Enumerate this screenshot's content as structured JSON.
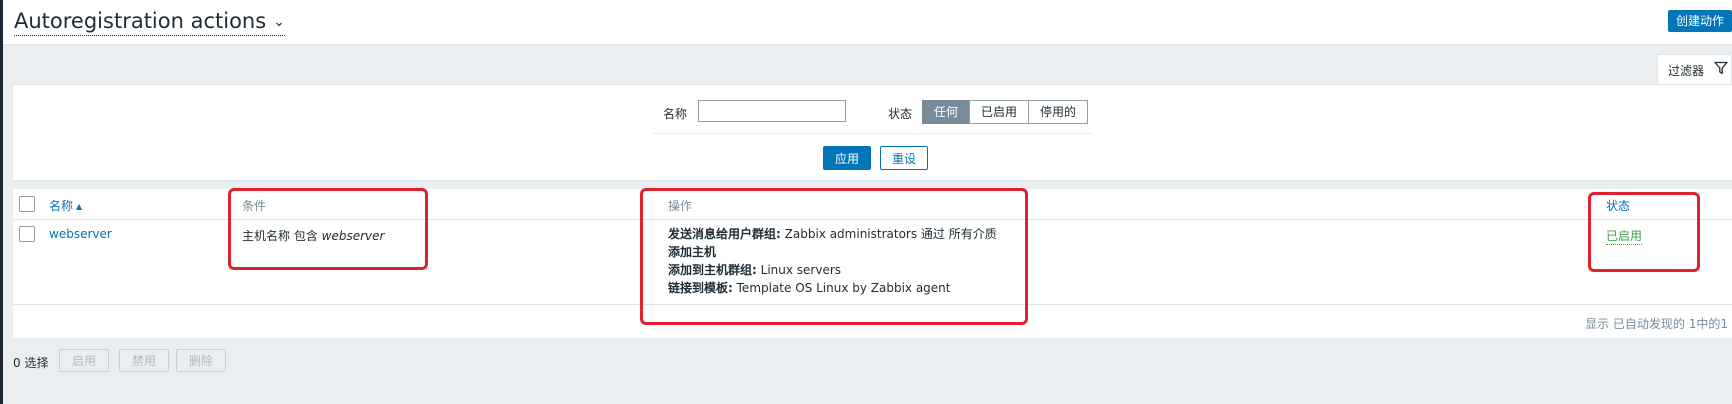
{
  "header": {
    "title": "Autoregistration actions",
    "create_button": "创建动作"
  },
  "filter": {
    "tab_label": "过滤器",
    "name_label": "名称",
    "name_value": "",
    "status_label": "状态",
    "status_options": [
      "任何",
      "已启用",
      "停用的"
    ],
    "status_selected": "任何",
    "apply_button": "应用",
    "reset_button": "重设"
  },
  "table": {
    "columns": {
      "name": "名称",
      "conditions": "条件",
      "operations": "操作",
      "status": "状态"
    },
    "rows": [
      {
        "name": "webserver",
        "condition_prefix": "主机名称 包含",
        "condition_value": "webserver",
        "operations": [
          {
            "label": "发送消息给用户群组:",
            "value": "Zabbix administrators 通过 所有介质"
          },
          {
            "label": "添加主机",
            "value": ""
          },
          {
            "label": "添加到主机群组:",
            "value": "Linux servers"
          },
          {
            "label": "链接到模板:",
            "value": "Template OS Linux by Zabbix agent"
          }
        ],
        "status": "已启用"
      }
    ],
    "footer": "显示 已自动发现的 1中的1"
  },
  "actions_bar": {
    "selected": "0 选择",
    "enable_button": "启用",
    "disable_button": "禁用",
    "delete_button": "删除"
  },
  "colors": {
    "accent": "#0275b8",
    "enabled_status": "#429e47",
    "annotation": "#e0212e"
  }
}
